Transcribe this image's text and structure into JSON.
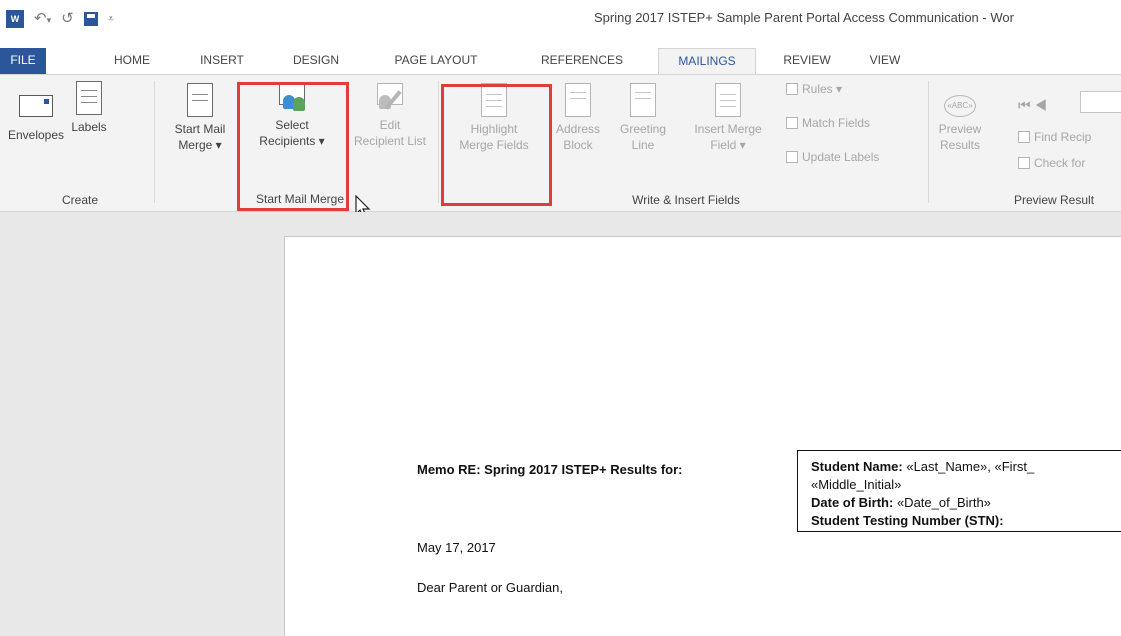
{
  "app": {
    "title": "Spring 2017 ISTEP+ Sample Parent Portal Access Communication - Wor",
    "logo": "W"
  },
  "ribbon_tabs": [
    {
      "label": "FILE"
    },
    {
      "label": "HOME"
    },
    {
      "label": "INSERT"
    },
    {
      "label": "DESIGN"
    },
    {
      "label": "PAGE LAYOUT"
    },
    {
      "label": "REFERENCES"
    },
    {
      "label": "MAILINGS",
      "active": true
    },
    {
      "label": "REVIEW"
    },
    {
      "label": "VIEW"
    }
  ],
  "groups": {
    "create": {
      "label": "Create",
      "envelopes": "Envelopes",
      "labels": "Labels"
    },
    "start_mail_merge": {
      "label": "Start Mail Merge",
      "start_line1": "Start Mail",
      "start_line2": "Merge ▾",
      "select_line1": "Select",
      "select_line2": "Recipients ▾",
      "edit_line1": "Edit",
      "edit_line2": "Recipient List"
    },
    "write_insert": {
      "label": "Write & Insert Fields",
      "highlight_line1": "Highlight",
      "highlight_line2": "Merge Fields",
      "address_line1": "Address",
      "address_line2": "Block",
      "greeting_line1": "Greeting",
      "greeting_line2": "Line",
      "insert_line1": "Insert Merge",
      "insert_line2": "Field ▾",
      "rules": "Rules ▾",
      "match_fields": "Match Fields",
      "update_labels": "Update Labels"
    },
    "preview": {
      "label": "Preview Result",
      "preview_line1": "Preview",
      "preview_line2": "Results",
      "find_recipient": "Find Recip",
      "check_for": "Check for",
      "icon_text": "«ABC»"
    }
  },
  "document": {
    "memo": "Memo RE: Spring 2017 ISTEP+ Results for:",
    "student_name_label": "Student Name:",
    "student_name_value": " «Last_Name», «First_",
    "middle_initial": "«Middle_Initial»",
    "dob_label": "Date of Birth:",
    "dob_value": " «Date_of_Birth»",
    "stn_label": "Student Testing Number (STN):",
    "date": "May 17, 2017",
    "salutation": "Dear Parent or Guardian,"
  },
  "colors": {
    "accent": "#2b579a",
    "highlight_box": "#e03c3c",
    "people_blue": "#3d8ed6",
    "people_green": "#5ba35b"
  }
}
